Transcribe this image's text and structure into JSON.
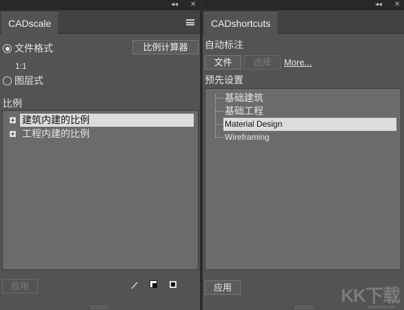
{
  "left_panel": {
    "tab_title": "CADscale",
    "radio_file_format": "文件格式",
    "scale_value": "1:1",
    "calculator_button": "比例计算器",
    "radio_layer_format": "图层式",
    "section_label": "比例",
    "tree_items": [
      "建筑内建的比例",
      "工程内建的比例"
    ],
    "apply_button": "应用"
  },
  "right_panel": {
    "tab_title": "CADshortcuts",
    "section_auto_label": "自动标注",
    "file_button": "文件",
    "select_button": "选择",
    "more_link": "More...",
    "section_presets": "预先设置",
    "tree_items": [
      "基础建筑",
      "基础工程",
      "Material Design",
      "Wireframing"
    ],
    "apply_button": "应用"
  },
  "window_controls": {
    "collapse": "◂◂",
    "close": "✕"
  },
  "watermark": {
    "text": "KK下载",
    "sub": "www.kkx.net"
  },
  "colors": {
    "panel_bg": "#535353",
    "selected_row": "#dcdcdc",
    "list_bg": "#6b6b6b"
  }
}
